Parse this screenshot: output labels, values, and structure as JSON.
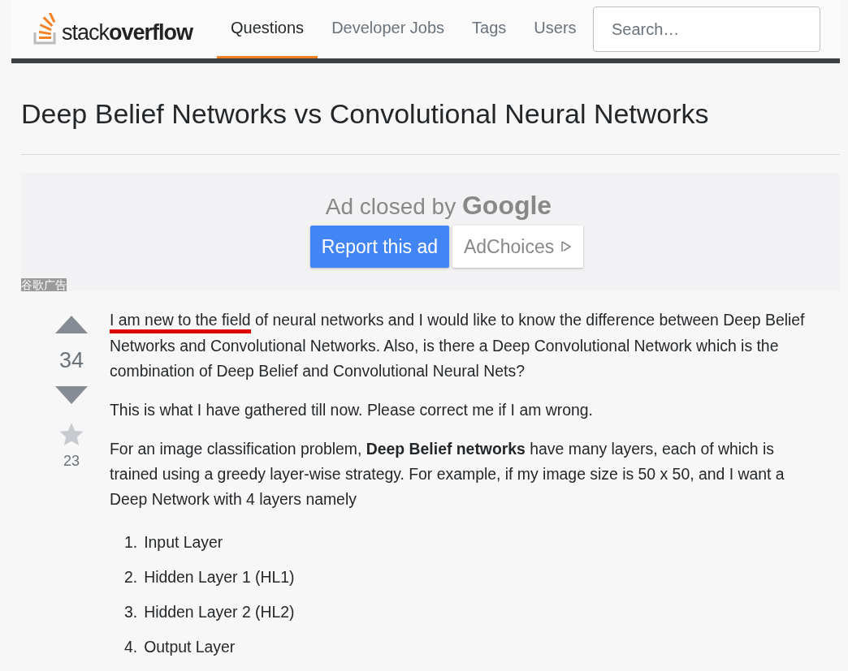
{
  "header": {
    "logo": {
      "light": "stack",
      "bold": "overflow"
    },
    "nav": [
      {
        "label": "Questions",
        "selected": true
      },
      {
        "label": "Developer Jobs",
        "selected": false
      },
      {
        "label": "Tags",
        "selected": false
      },
      {
        "label": "Users",
        "selected": false
      }
    ],
    "search": {
      "placeholder": "Search…"
    }
  },
  "question": {
    "title": "Deep Belief Networks vs Convolutional Neural Networks"
  },
  "ad": {
    "text": "Ad closed by",
    "brand": "Google",
    "buttons": [
      {
        "label": "Report this ad",
        "kind": "primary"
      },
      {
        "label": "AdChoices",
        "kind": "choices"
      }
    ],
    "label": "谷歌广告"
  },
  "post": {
    "votes": "34",
    "favorites": "23",
    "paragraphs": [
      {
        "marked": "I am new to the field",
        "text": " of neural networks and I would like to know the difference between Deep Belief Networks and Convolutional Networks. Also, is there a Deep Convolutional Network which is the combination of Deep Belief and Convolutional Neural Nets?"
      },
      {
        "text": "This is what I have gathered till now. Please correct me if I am wrong."
      },
      {
        "text": "For an image classification problem, **Deep Belief networks** have many layers, each of which is trained using a greedy layer-wise strategy. For example, if my image size is 50 x 50, and I want a Deep Network with 4 layers namely"
      }
    ],
    "list": [
      {
        "number": "1.",
        "text": "Input Layer"
      },
      {
        "number": "2.",
        "text": "Hidden Layer 1 (HL1)"
      },
      {
        "number": "3.",
        "text": "Hidden Layer 2 (HL2)"
      },
      {
        "number": "4.",
        "text": "Output Layer"
      }
    ]
  }
}
